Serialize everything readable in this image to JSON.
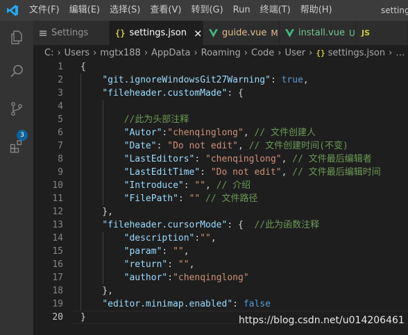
{
  "menu": [
    "文件(F)",
    "编辑(E)",
    "选择(S)",
    "查看(V)",
    "转到(G)",
    "Run",
    "终端(T)",
    "帮助(H)"
  ],
  "window_title": "settings",
  "activity_bar": {
    "items": [
      "explorer",
      "search",
      "source-control",
      "extensions"
    ],
    "scm_badge": "3"
  },
  "tabs": [
    {
      "label": "Settings",
      "status": "",
      "icon": "settings-lines-icon"
    },
    {
      "label": "settings.json",
      "status": "×",
      "icon": "json-braces-icon"
    },
    {
      "label": "guide.vue",
      "status": "M",
      "icon": "vue-icon"
    },
    {
      "label": "install.vue",
      "status": "U",
      "icon": "vue-icon"
    },
    {
      "label": "JS",
      "status": "",
      "icon": "js-icon"
    }
  ],
  "breadcrumb": {
    "parts": [
      "C:",
      "Users",
      "mgtx188",
      "AppData",
      "Roaming",
      "Code",
      "User"
    ],
    "file_icon": "{}",
    "file": "settings.json",
    "ellipsis": "…"
  },
  "editor": {
    "current_line": 20,
    "lines": [
      {
        "n": "1",
        "t": [
          [
            "pun",
            "{"
          ]
        ]
      },
      {
        "n": "2",
        "t": [
          [
            "pun",
            "    "
          ],
          [
            "key",
            "\"git.ignoreWindowsGit27Warning\""
          ],
          [
            "pun",
            ": "
          ],
          [
            "kw",
            "true"
          ],
          [
            "pun",
            ","
          ]
        ]
      },
      {
        "n": "3",
        "t": [
          [
            "pun",
            "    "
          ],
          [
            "key",
            "\"fileheader.customMade\""
          ],
          [
            "pun",
            ": {"
          ]
        ]
      },
      {
        "n": "4",
        "t": []
      },
      {
        "n": "5",
        "t": [
          [
            "pun",
            "        "
          ],
          [
            "cmt",
            "//此为头部注释"
          ]
        ]
      },
      {
        "n": "6",
        "t": [
          [
            "pun",
            "        "
          ],
          [
            "key",
            "\"Autor\""
          ],
          [
            "pun",
            ":"
          ],
          [
            "str",
            "\"chenqinglong\""
          ],
          [
            "pun",
            ", "
          ],
          [
            "cmt",
            "// 文件创建人"
          ]
        ]
      },
      {
        "n": "7",
        "t": [
          [
            "pun",
            "        "
          ],
          [
            "key",
            "\"Date\""
          ],
          [
            "pun",
            ": "
          ],
          [
            "str",
            "\"Do not edit\""
          ],
          [
            "pun",
            ", "
          ],
          [
            "cmt",
            "// 文件创建时间(不变)"
          ]
        ]
      },
      {
        "n": "8",
        "t": [
          [
            "pun",
            "        "
          ],
          [
            "key",
            "\"LastEditors\""
          ],
          [
            "pun",
            ": "
          ],
          [
            "str",
            "\"chenqinglong\""
          ],
          [
            "pun",
            ", "
          ],
          [
            "cmt",
            "// 文件最后编辑者"
          ]
        ]
      },
      {
        "n": "9",
        "t": [
          [
            "pun",
            "        "
          ],
          [
            "key",
            "\"LastEditTime\""
          ],
          [
            "pun",
            ": "
          ],
          [
            "str",
            "\"Do not edit\""
          ],
          [
            "pun",
            ", "
          ],
          [
            "cmt",
            "// 文件最后编辑时间"
          ]
        ]
      },
      {
        "n": "10",
        "t": [
          [
            "pun",
            "        "
          ],
          [
            "key",
            "\"Introduce\""
          ],
          [
            "pun",
            ": "
          ],
          [
            "str",
            "\"\""
          ],
          [
            "pun",
            ", "
          ],
          [
            "cmt",
            "// 介绍"
          ]
        ]
      },
      {
        "n": "11",
        "t": [
          [
            "pun",
            "        "
          ],
          [
            "key",
            "\"FilePath\""
          ],
          [
            "pun",
            ": "
          ],
          [
            "str",
            "\"\""
          ],
          [
            "pun",
            " "
          ],
          [
            "cmt",
            "// 文件路径"
          ]
        ]
      },
      {
        "n": "12",
        "t": [
          [
            "pun",
            "    },"
          ]
        ]
      },
      {
        "n": "13",
        "t": [
          [
            "pun",
            "    "
          ],
          [
            "key",
            "\"fileheader.cursorMode\""
          ],
          [
            "pun",
            ": {  "
          ],
          [
            "cmt",
            "//此为函数注释"
          ]
        ]
      },
      {
        "n": "14",
        "t": [
          [
            "pun",
            "        "
          ],
          [
            "key",
            "\"description\""
          ],
          [
            "pun",
            ":"
          ],
          [
            "str",
            "\"\""
          ],
          [
            "pun",
            ","
          ]
        ]
      },
      {
        "n": "15",
        "t": [
          [
            "pun",
            "        "
          ],
          [
            "key",
            "\"param\""
          ],
          [
            "pun",
            ": "
          ],
          [
            "str",
            "\"\""
          ],
          [
            "pun",
            ","
          ]
        ]
      },
      {
        "n": "16",
        "t": [
          [
            "pun",
            "        "
          ],
          [
            "key",
            "\"return\""
          ],
          [
            "pun",
            ": "
          ],
          [
            "str",
            "\"\""
          ],
          [
            "pun",
            ","
          ]
        ]
      },
      {
        "n": "17",
        "t": [
          [
            "pun",
            "        "
          ],
          [
            "key",
            "\"author\""
          ],
          [
            "pun",
            ":"
          ],
          [
            "str",
            "\"chenqinglong\""
          ]
        ]
      },
      {
        "n": "18",
        "t": [
          [
            "pun",
            "    },"
          ]
        ]
      },
      {
        "n": "19",
        "t": [
          [
            "pun",
            "    "
          ],
          [
            "key",
            "\"editor.minimap.enabled\""
          ],
          [
            "pun",
            ": "
          ],
          [
            "kw",
            "false"
          ]
        ]
      },
      {
        "n": "20",
        "t": [
          [
            "pun",
            "}"
          ]
        ]
      }
    ]
  },
  "watermark": "https://blog.csdn.net/u014206461",
  "colors": {
    "key": "#9cdcfe",
    "string": "#ce9178",
    "keyword": "#569cd6",
    "comment": "#6a9955",
    "vue": "#41b883",
    "modified": "#e2c08d",
    "untracked": "#73c991",
    "json": "#cbcb41",
    "badge": "#0e639c"
  }
}
